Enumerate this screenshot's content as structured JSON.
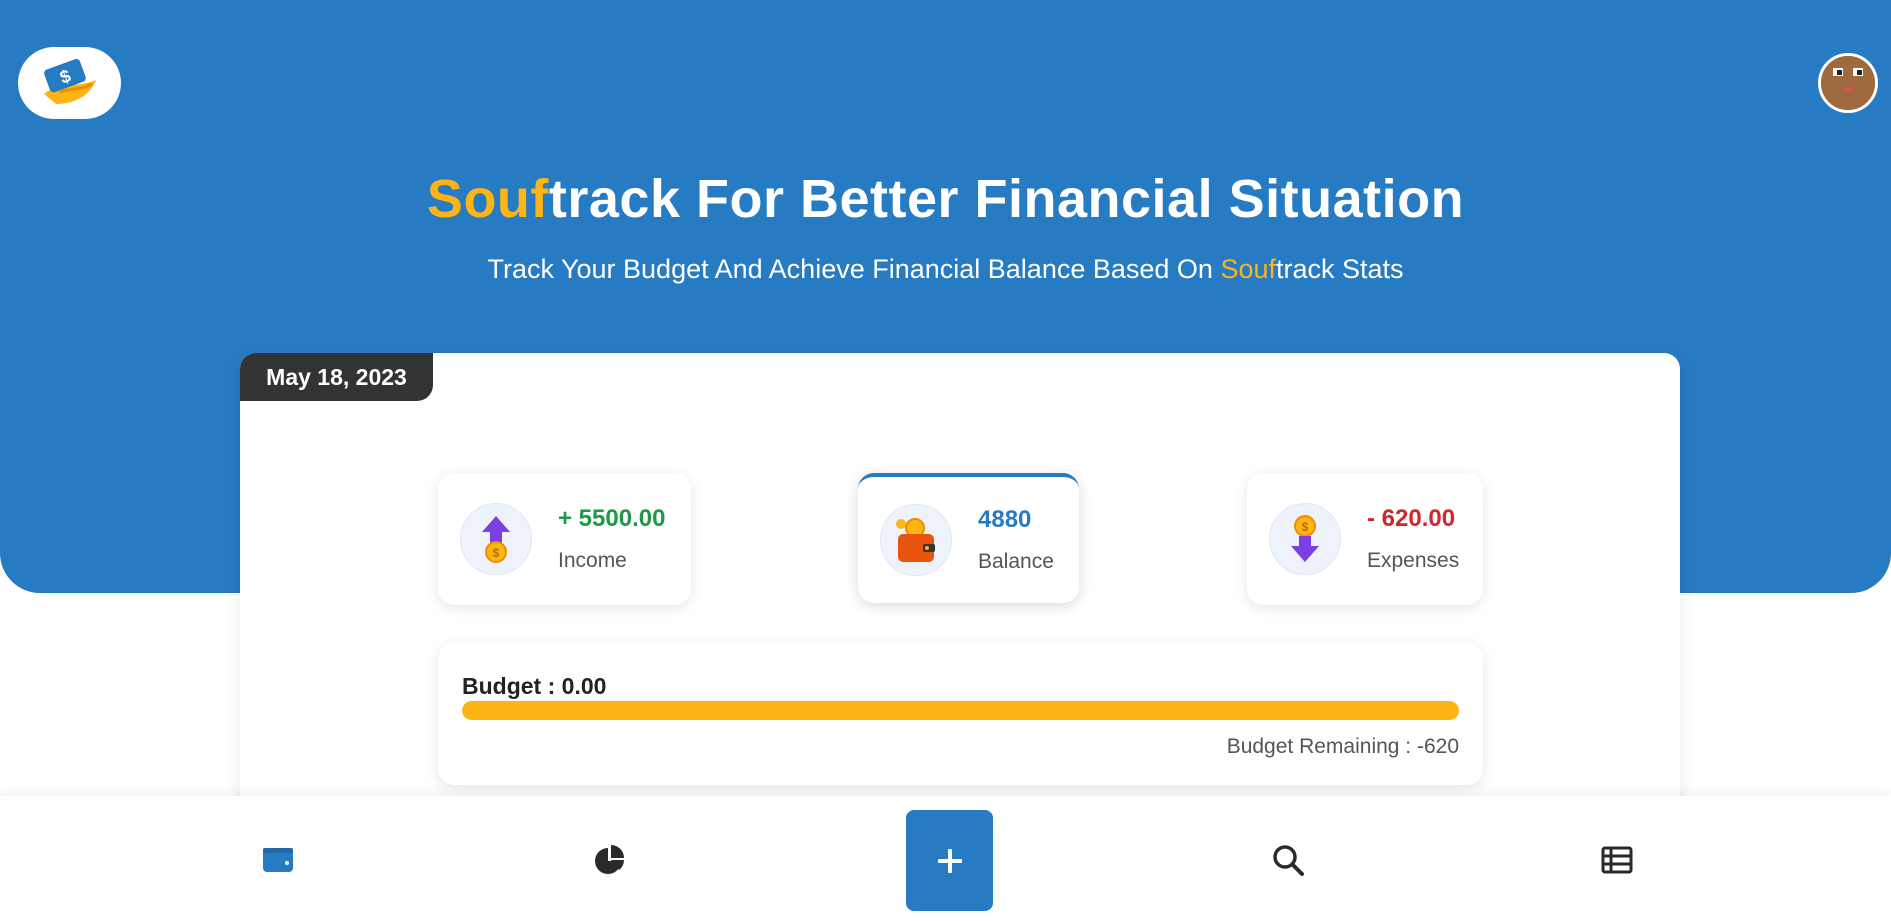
{
  "header": {
    "title_accent": "Souf",
    "title_rest": "track For Better Financial Situation",
    "subtitle_prefix": "Track Your Budget And Achieve Financial Balance Based On ",
    "subtitle_accent": "Souf",
    "subtitle_suffix": "track Stats"
  },
  "dashboard": {
    "date": "May 18, 2023",
    "income": {
      "value": "+ 5500.00",
      "label": "Income"
    },
    "balance": {
      "value": "4880",
      "label": "Balance"
    },
    "expenses": {
      "value": "- 620.00",
      "label": "Expenses"
    },
    "budget": {
      "label": "Budget : 0.00",
      "remaining": "Budget Remaining : -620",
      "progress_percent": 100
    }
  },
  "nav": {
    "items": [
      {
        "icon": "wallet-icon",
        "active": true
      },
      {
        "icon": "pie-chart-icon"
      },
      {
        "icon": "plus-icon"
      },
      {
        "icon": "search-icon"
      },
      {
        "icon": "table-list-icon"
      }
    ]
  },
  "colors": {
    "primary": "#277bc2",
    "accent": "#fdb515",
    "income": "#1e9a47",
    "expenses": "#d0262c",
    "dark": "#333333"
  }
}
